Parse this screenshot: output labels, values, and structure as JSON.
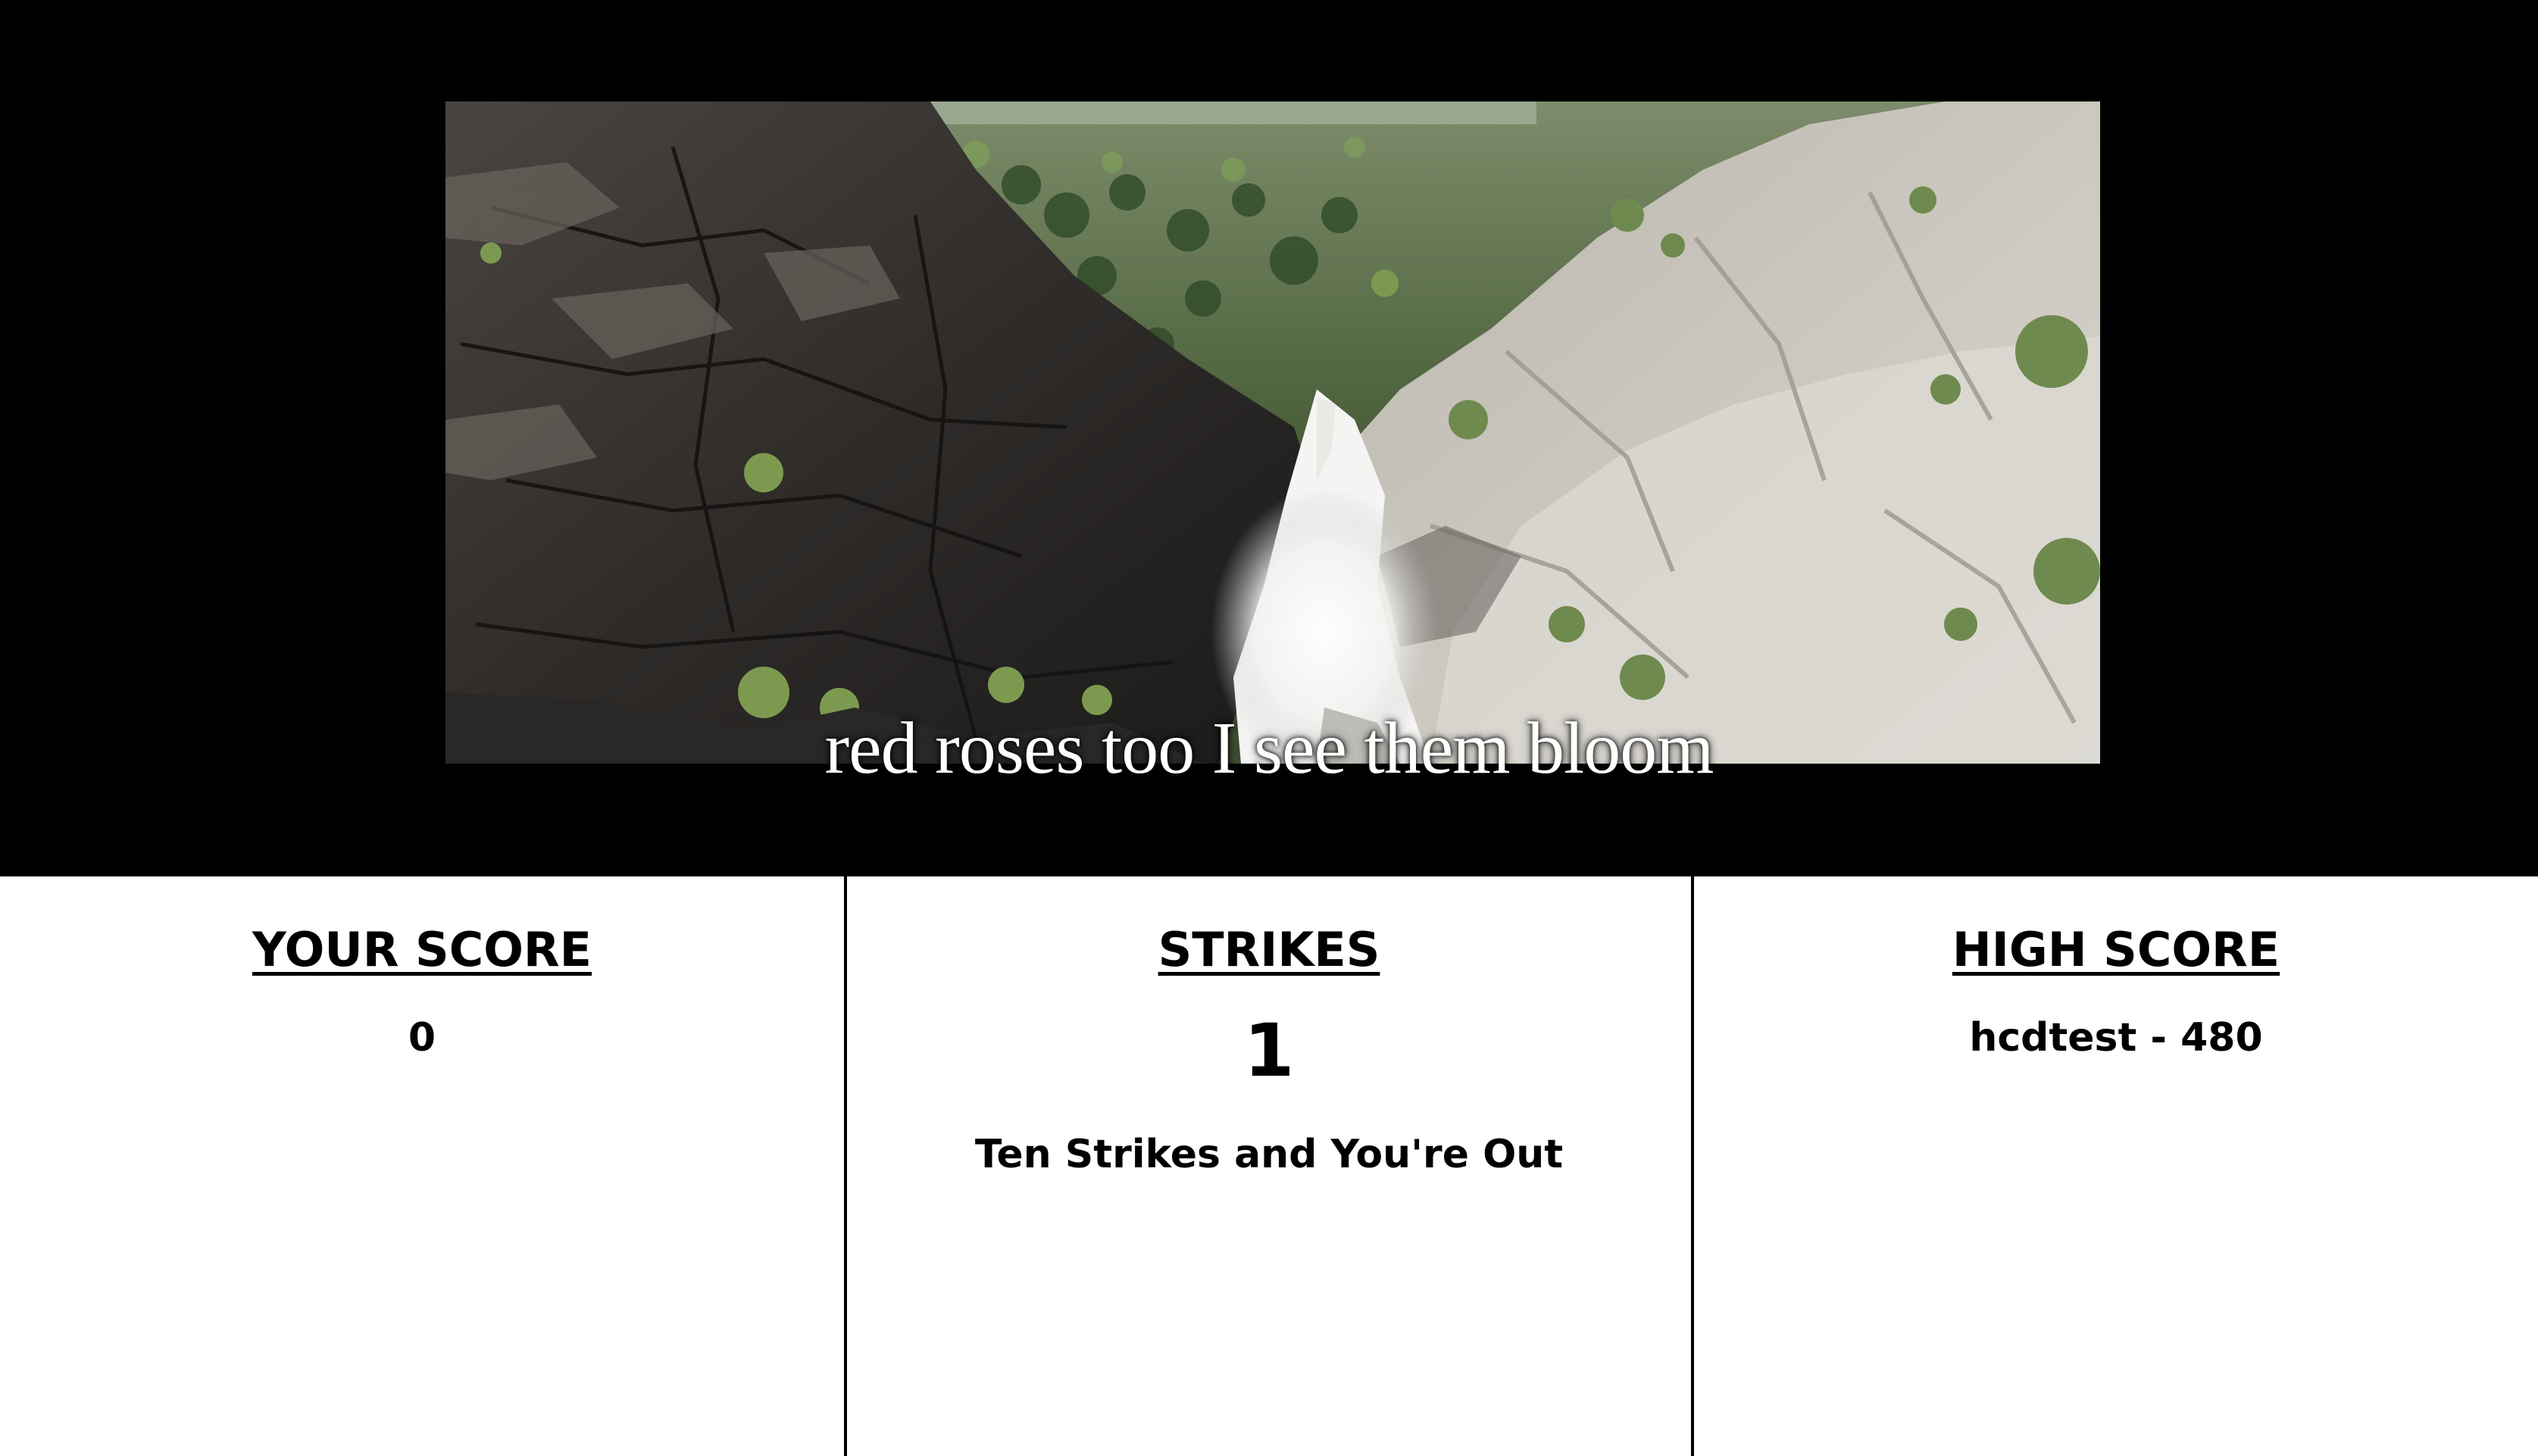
{
  "video": {
    "caption": "red roses too I see them bloom"
  },
  "scoreboard": {
    "your_score": {
      "title": "YOUR SCORE",
      "value": "0"
    },
    "strikes": {
      "title": "STRIKES",
      "value": "1",
      "note": "Ten Strikes and You're Out"
    },
    "high_score": {
      "title": "HIGH SCORE",
      "value": "hcdtest - 480"
    }
  }
}
